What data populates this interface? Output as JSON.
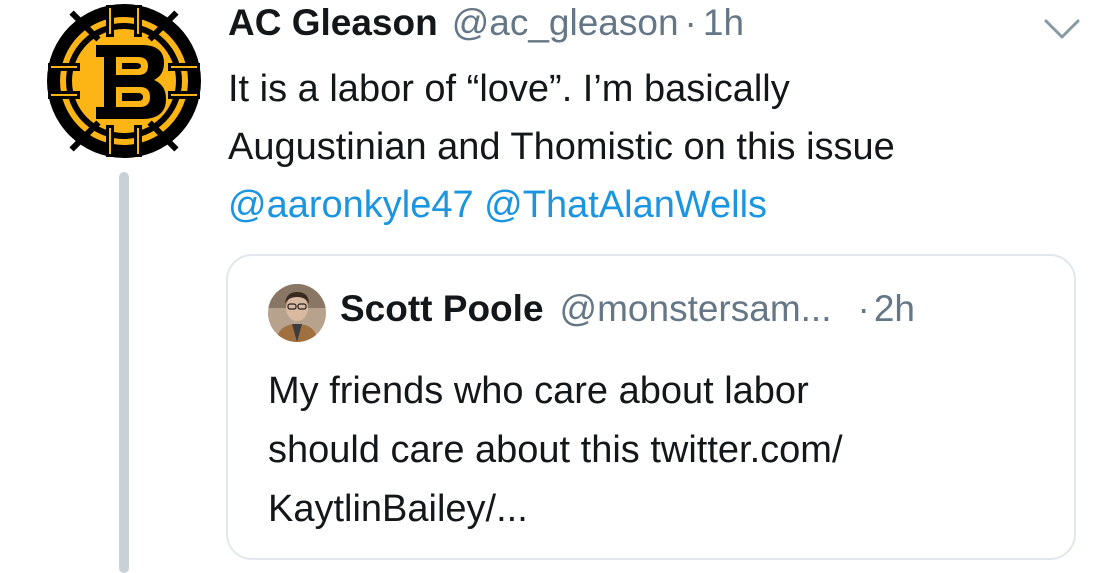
{
  "tweet": {
    "author": {
      "name": "AC Gleason",
      "handle": "@ac_gleason",
      "separator": "·",
      "time": "1h"
    },
    "text_lines": [
      "It is a labor of “love”. I’m basically",
      "Augustinian and Thomistic on this issue"
    ],
    "mentions": [
      "@aaronkyle47",
      "@ThatAlanWells"
    ],
    "menu_icon": "chevron-down-icon"
  },
  "quote": {
    "author": {
      "name": "Scott Poole",
      "handle": "@monstersam...",
      "separator": "·",
      "time": "2h"
    },
    "text_lines": [
      "My friends who care about labor",
      "should care about this twitter.com/",
      "KaytlinBailey/..."
    ]
  },
  "colors": {
    "text": "#14171a",
    "secondary": "#657786",
    "link": "#1b95e0",
    "border": "#e1e8ed",
    "thread_line": "#c9d1d8",
    "bruins_gold": "#fcb514",
    "bruins_black": "#000000"
  }
}
